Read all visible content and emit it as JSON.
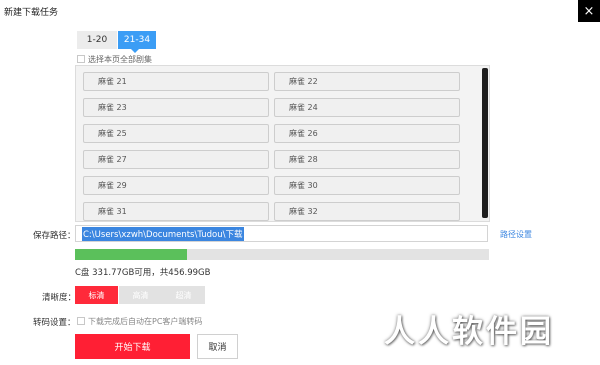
{
  "dialog": {
    "title": "新建下载任务",
    "close_glyph": "×"
  },
  "range_tabs": [
    {
      "label": "1-20",
      "selected": false
    },
    {
      "label": "21-34",
      "selected": true
    }
  ],
  "select_all": {
    "label": "选择本页全部剧集",
    "checked": false
  },
  "episodes": [
    {
      "label": "麻雀 21"
    },
    {
      "label": "麻雀 22"
    },
    {
      "label": "麻雀 23"
    },
    {
      "label": "麻雀 24"
    },
    {
      "label": "麻雀 25"
    },
    {
      "label": "麻雀 26"
    },
    {
      "label": "麻雀 27"
    },
    {
      "label": "麻雀 28"
    },
    {
      "label": "麻雀 29"
    },
    {
      "label": "麻雀 30"
    },
    {
      "label": "麻雀 31"
    },
    {
      "label": "麻雀 32"
    }
  ],
  "save_path": {
    "label": "保存路径：",
    "value": "C:\\Users\\xzwh\\Documents\\Tudou\\下载",
    "settings_link": "路径设置"
  },
  "disk": {
    "info": "C盘 331.77GB可用，共456.99GB",
    "used_fraction": 0.27,
    "fill_color": "#5bc05b"
  },
  "quality": {
    "label": "清晰度：",
    "options": [
      {
        "label": "标清",
        "selected": true
      },
      {
        "label": "高清",
        "selected": false
      },
      {
        "label": "超清",
        "selected": false
      }
    ],
    "accent_color": "#ff2a3a"
  },
  "transcode": {
    "label": "转码设置：",
    "option_text": "下载完成后自动在PC客户端转码",
    "checked": false
  },
  "actions": {
    "start_label": "开始下载",
    "cancel_label": "取消",
    "start_color": "#ff1f34"
  },
  "watermark": {
    "text": "人人软件园"
  }
}
